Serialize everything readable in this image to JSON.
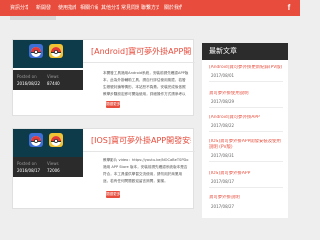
{
  "nav": {
    "items": [
      "資訊分享",
      "新開發",
      "使用指南",
      "相關介紹",
      "其他分享",
      "常見問題",
      "聯繫方式",
      "關於我們"
    ],
    "facebook_icon": "facebook-icon",
    "glyph": "f"
  },
  "posts": [
    {
      "title": "[Android]寶可夢外掛APP開發安裝及使用",
      "posted_on_label": "Posted on",
      "posted_on": "2016/08/22",
      "views_label": "Views",
      "views": "87440",
      "excerpt": "本開發工具適用Android系統，安裝前請先確認APP版本，此為外掛輔助工具，請自行評估使用風險，若發生帳號封鎖等情形，本站恕不負責。安裝完成後依照教學步驟設定即可開始使用，詳細操作方式請參考以下說明，如有問題請於下方留言，將盡快回覆。（Play 商店版）",
      "read_more": "閱讀更多"
    },
    {
      "title": "[IOS]寶可夢外掛APP開發安裝及使用",
      "posted_on_label": "Posted on",
      "posted_on": "2016/08/17",
      "views_label": "Views",
      "views": "72006",
      "excerpt": "教學影片 video：https://youtu.be/NOCaBeTSPDo 適用 APP Store 版本，安裝前請先確認系統版本是否符合，本工具僅供學習交流使用，請勿用於商業用途，若有任何問題歡迎留言詢問，謝謝。",
      "read_more": "閱讀更多"
    }
  ],
  "sidebar": {
    "title": "最新文章",
    "items": [
      {
        "title": "[Android]寶可夢外掛更新紀錄(PV版)",
        "date": "2017/08/01"
      },
      {
        "title": "寶可夢外掛使用說明",
        "date": "2017/08/29"
      },
      {
        "title": "[Android]寶可夢外掛APP",
        "date": "2017/08/22"
      },
      {
        "title": "[IOS]寶可夢外掛APP開發安裝及使用說明 (PV版)",
        "date": "2017/08/31"
      },
      {
        "title": "[IOS]寶可夢外掛APP",
        "date": "2017/08/17"
      },
      {
        "title": "寶可夢外掛說明",
        "date": "2017/08/27"
      }
    ]
  }
}
